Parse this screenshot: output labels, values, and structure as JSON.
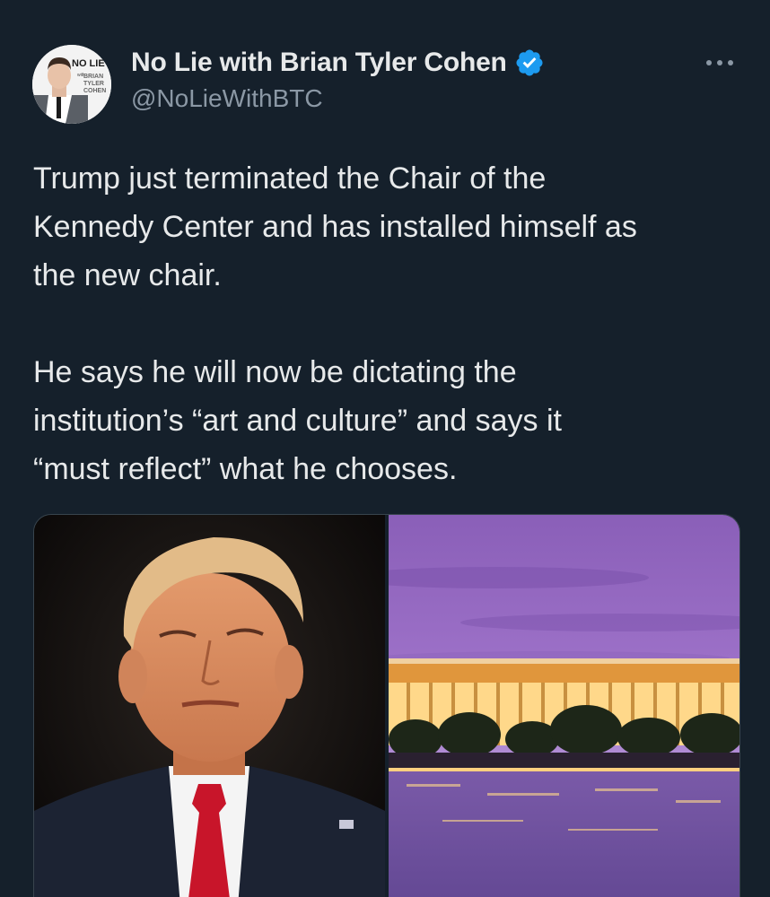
{
  "tweet": {
    "author": {
      "display_name": "No Lie with Brian Tyler Cohen",
      "handle": "@NoLieWithBTC",
      "avatar_badge": {
        "line1": "NO LIE",
        "line2": "with",
        "line3": "BRIAN",
        "line4": "TYLER",
        "line5": "COHEN"
      },
      "verified": true
    },
    "text": "Trump just terminated the Chair of the\nKennedy Center and has installed himself as\nthe new chair.\n\nHe says he will now be dictating the\ninstitution’s “art and culture” and says it\n“must reflect” what he chooses.",
    "media_count": 2
  },
  "icons": {
    "verified": "verified-badge-icon",
    "more": "more-options-icon"
  },
  "colors": {
    "background": "#15202b",
    "text": "#e7e9ea",
    "secondary_text": "#8b98a5",
    "verified": "#1d9bf0",
    "border": "#38444d"
  }
}
